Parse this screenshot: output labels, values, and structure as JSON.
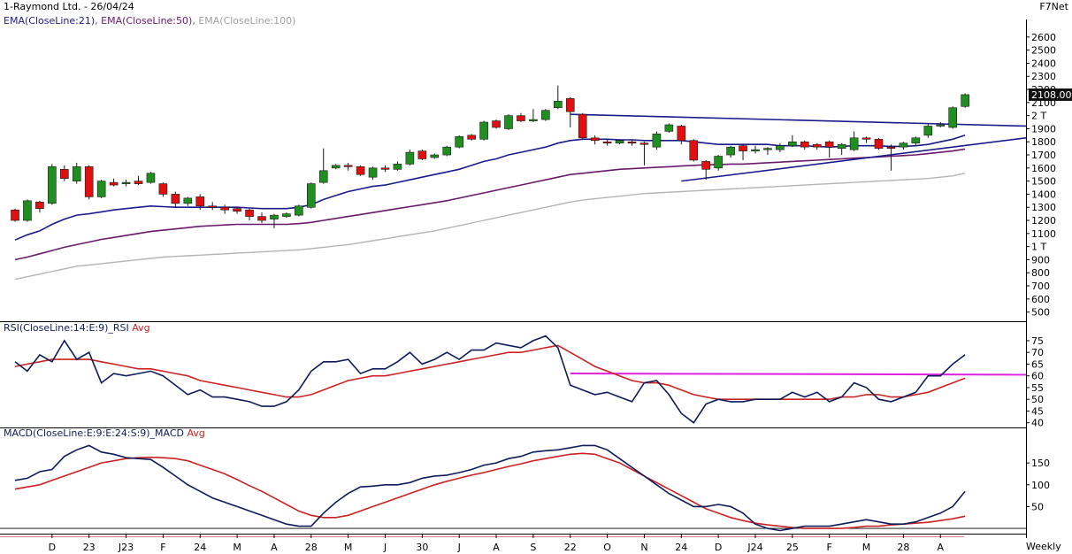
{
  "header": {
    "title": "1-Raymond Ltd. - 26/04/24",
    "brand": "F7Net",
    "ema_legend": [
      "EMA(CloseLine:21)",
      "EMA(CloseLine:50)",
      "EMA(CloseLine:100)"
    ],
    "rsi_label": "RSI(CloseLine:14:E:9)_RSI",
    "rsi_avg_label": "Avg",
    "macd_label": "MACD(CloseLine:E:9:E:24:S:9)_MACD",
    "macd_avg_label": "Avg",
    "last_price": "2108.00",
    "timeframe": "Weekly"
  },
  "colors": {
    "up": "#1f8f1f",
    "down": "#e01010",
    "ema21": "#1b1b8c",
    "ema50": "#6a1a6a",
    "ema100": "#b4b4b4",
    "rsi": "#0f1b5a",
    "rsi_avg": "#cc2222",
    "macd": "#0f1b5a",
    "macd_avg": "#cc2222",
    "level_line": "#e020e0"
  },
  "chart_data": [
    {
      "type": "candlestick",
      "panel": "price",
      "y_axis_labels": [
        "2600",
        "2500",
        "2400",
        "2300",
        "2200",
        "2100",
        "2 T",
        "1900",
        "1800",
        "1700",
        "1600",
        "1500",
        "1400",
        "1300",
        "1200",
        "1100",
        "1 T",
        "900",
        "800",
        "700",
        "600",
        "500"
      ],
      "ylim": [
        430,
        2680
      ],
      "candles": [
        [
          1280,
          1200,
          1290,
          1190
        ],
        [
          1200,
          1350,
          1360,
          1190
        ],
        [
          1340,
          1290,
          1350,
          1260
        ],
        [
          1330,
          1610,
          1630,
          1320
        ],
        [
          1590,
          1520,
          1620,
          1500
        ],
        [
          1500,
          1610,
          1640,
          1480
        ],
        [
          1610,
          1380,
          1620,
          1360
        ],
        [
          1380,
          1500,
          1510,
          1370
        ],
        [
          1490,
          1470,
          1520,
          1460
        ],
        [
          1480,
          1490,
          1510,
          1460
        ],
        [
          1500,
          1480,
          1540,
          1470
        ],
        [
          1490,
          1560,
          1570,
          1480
        ],
        [
          1480,
          1400,
          1490,
          1380
        ],
        [
          1400,
          1330,
          1420,
          1300
        ],
        [
          1330,
          1370,
          1380,
          1310
        ],
        [
          1380,
          1310,
          1400,
          1280
        ],
        [
          1310,
          1300,
          1340,
          1280
        ],
        [
          1300,
          1280,
          1320,
          1250
        ],
        [
          1290,
          1270,
          1300,
          1250
        ],
        [
          1280,
          1230,
          1290,
          1200
        ],
        [
          1230,
          1200,
          1260,
          1180
        ],
        [
          1210,
          1240,
          1250,
          1140
        ],
        [
          1230,
          1250,
          1260,
          1220
        ],
        [
          1240,
          1310,
          1320,
          1230
        ],
        [
          1300,
          1480,
          1490,
          1290
        ],
        [
          1490,
          1580,
          1750,
          1480
        ],
        [
          1600,
          1620,
          1630,
          1590
        ],
        [
          1620,
          1610,
          1640,
          1580
        ],
        [
          1610,
          1550,
          1620,
          1540
        ],
        [
          1530,
          1600,
          1610,
          1510
        ],
        [
          1600,
          1590,
          1620,
          1570
        ],
        [
          1590,
          1630,
          1650,
          1580
        ],
        [
          1630,
          1720,
          1740,
          1620
        ],
        [
          1730,
          1670,
          1740,
          1660
        ],
        [
          1680,
          1700,
          1710,
          1670
        ],
        [
          1700,
          1760,
          1770,
          1690
        ],
        [
          1760,
          1840,
          1850,
          1750
        ],
        [
          1850,
          1820,
          1860,
          1810
        ],
        [
          1820,
          1950,
          1960,
          1810
        ],
        [
          1960,
          1910,
          1970,
          1900
        ],
        [
          1900,
          2000,
          2010,
          1890
        ],
        [
          2000,
          1960,
          2020,
          1950
        ],
        [
          1960,
          1970,
          2050,
          1950
        ],
        [
          1970,
          2040,
          2050,
          1960
        ],
        [
          2060,
          2110,
          2230,
          2050
        ],
        [
          2130,
          2030,
          2140,
          1910
        ],
        [
          2010,
          1830,
          2020,
          1820
        ],
        [
          1830,
          1810,
          1850,
          1780
        ],
        [
          1800,
          1790,
          1820,
          1770
        ],
        [
          1790,
          1810,
          1820,
          1780
        ],
        [
          1800,
          1790,
          1820,
          1770
        ],
        [
          1790,
          1780,
          1800,
          1620
        ],
        [
          1760,
          1860,
          1880,
          1740
        ],
        [
          1880,
          1930,
          1940,
          1870
        ],
        [
          1920,
          1810,
          1930,
          1780
        ],
        [
          1810,
          1660,
          1820,
          1650
        ],
        [
          1650,
          1590,
          1660,
          1510
        ],
        [
          1600,
          1690,
          1700,
          1580
        ],
        [
          1700,
          1760,
          1770,
          1680
        ],
        [
          1770,
          1730,
          1780,
          1660
        ],
        [
          1730,
          1740,
          1770,
          1710
        ],
        [
          1740,
          1750,
          1760,
          1700
        ],
        [
          1740,
          1770,
          1790,
          1720
        ],
        [
          1770,
          1800,
          1850,
          1760
        ],
        [
          1800,
          1760,
          1810,
          1740
        ],
        [
          1780,
          1760,
          1790,
          1740
        ],
        [
          1800,
          1760,
          1810,
          1680
        ],
        [
          1750,
          1780,
          1790,
          1700
        ],
        [
          1740,
          1830,
          1880,
          1730
        ],
        [
          1830,
          1820,
          1840,
          1790
        ],
        [
          1820,
          1750,
          1830,
          1740
        ],
        [
          1760,
          1750,
          1780,
          1580
        ],
        [
          1760,
          1790,
          1800,
          1740
        ],
        [
          1790,
          1830,
          1840,
          1770
        ],
        [
          1850,
          1920,
          1940,
          1830
        ],
        [
          1930,
          1930,
          1950,
          1910
        ],
        [
          1910,
          2060,
          2070,
          1900
        ],
        [
          2070,
          2160,
          2170,
          2060
        ]
      ],
      "ema21": [
        1050,
        1090,
        1120,
        1170,
        1210,
        1240,
        1250,
        1265,
        1280,
        1290,
        1300,
        1310,
        1305,
        1300,
        1300,
        1300,
        1300,
        1300,
        1300,
        1295,
        1290,
        1290,
        1290,
        1300,
        1320,
        1360,
        1390,
        1420,
        1440,
        1460,
        1470,
        1490,
        1510,
        1530,
        1550,
        1570,
        1590,
        1620,
        1650,
        1670,
        1700,
        1720,
        1740,
        1760,
        1790,
        1810,
        1820,
        1820,
        1820,
        1815,
        1815,
        1810,
        1810,
        1810,
        1810,
        1800,
        1790,
        1780,
        1780,
        1780,
        1780,
        1780,
        1770,
        1770,
        1770,
        1765,
        1760,
        1765,
        1770,
        1770,
        1770,
        1765,
        1765,
        1770,
        1780,
        1800,
        1820,
        1850
      ],
      "ema50": [
        900,
        920,
        945,
        970,
        995,
        1015,
        1035,
        1055,
        1070,
        1085,
        1100,
        1115,
        1125,
        1135,
        1145,
        1155,
        1160,
        1165,
        1170,
        1170,
        1170,
        1170,
        1170,
        1175,
        1185,
        1200,
        1215,
        1230,
        1245,
        1260,
        1275,
        1290,
        1305,
        1320,
        1335,
        1350,
        1370,
        1390,
        1410,
        1430,
        1450,
        1470,
        1490,
        1510,
        1530,
        1550,
        1560,
        1570,
        1580,
        1590,
        1595,
        1600,
        1605,
        1610,
        1615,
        1620,
        1625,
        1625,
        1630,
        1630,
        1635,
        1640,
        1645,
        1650,
        1655,
        1660,
        1665,
        1670,
        1675,
        1680,
        1685,
        1690,
        1695,
        1700,
        1710,
        1720,
        1730,
        1745
      ],
      "ema100": [
        750,
        770,
        790,
        810,
        830,
        850,
        860,
        870,
        880,
        890,
        900,
        910,
        920,
        925,
        930,
        935,
        940,
        945,
        950,
        955,
        960,
        965,
        970,
        975,
        985,
        995,
        1005,
        1015,
        1030,
        1045,
        1060,
        1075,
        1090,
        1105,
        1120,
        1140,
        1160,
        1180,
        1200,
        1220,
        1240,
        1260,
        1280,
        1300,
        1320,
        1340,
        1355,
        1365,
        1375,
        1385,
        1395,
        1405,
        1410,
        1415,
        1420,
        1425,
        1430,
        1435,
        1440,
        1445,
        1450,
        1455,
        1460,
        1465,
        1470,
        1475,
        1480,
        1485,
        1490,
        1495,
        1500,
        1505,
        1510,
        1515,
        1520,
        1530,
        1540,
        1560
      ],
      "trendlines": [
        {
          "from": [
            45,
            2010
          ],
          "to": [
            107,
            1920
          ]
        },
        {
          "from": [
            54,
            1500
          ],
          "to": [
            107,
            1830
          ]
        }
      ],
      "x_labels": [
        {
          "i": 3,
          "t": "D"
        },
        {
          "i": 6,
          "t": "23"
        },
        {
          "i": 9,
          "t": "J23"
        },
        {
          "i": 12,
          "t": "F"
        },
        {
          "i": 15,
          "t": "24"
        },
        {
          "i": 18,
          "t": "M"
        },
        {
          "i": 21,
          "t": "A"
        },
        {
          "i": 24,
          "t": "28"
        },
        {
          "i": 27,
          "t": "M"
        },
        {
          "i": 30,
          "t": "J"
        },
        {
          "i": 33,
          "t": "30"
        },
        {
          "i": 36,
          "t": "J"
        },
        {
          "i": 39,
          "t": "A"
        },
        {
          "i": 42,
          "t": "S"
        },
        {
          "i": 45,
          "t": "22"
        },
        {
          "i": 48,
          "t": "O"
        },
        {
          "i": 51,
          "t": "N"
        },
        {
          "i": 54,
          "t": "24"
        },
        {
          "i": 57,
          "t": "D"
        },
        {
          "i": 60,
          "t": "J24"
        },
        {
          "i": 63,
          "t": "25"
        },
        {
          "i": 66,
          "t": "F"
        },
        {
          "i": 69,
          "t": "M"
        },
        {
          "i": 72,
          "t": "28"
        },
        {
          "i": 75,
          "t": "A"
        }
      ]
    },
    {
      "type": "line",
      "panel": "rsi",
      "y_axis_labels": [
        "75",
        "70",
        "65",
        "60",
        "55",
        "50",
        "45",
        "40"
      ],
      "ylim": [
        38,
        78
      ],
      "rsi": [
        66,
        62,
        69,
        66,
        75,
        67,
        70,
        57,
        61,
        60,
        61,
        62,
        60,
        56,
        52,
        54,
        51,
        51,
        50,
        49,
        47,
        47,
        49,
        54,
        62,
        66,
        66,
        67,
        61,
        63,
        63,
        66,
        70,
        65,
        67,
        70,
        67,
        71,
        71,
        74,
        73,
        72,
        75,
        77,
        72,
        56,
        54,
        52,
        53,
        51,
        49,
        57,
        58,
        52,
        44,
        40,
        48,
        50,
        49,
        49,
        50,
        50,
        50,
        53,
        51,
        53,
        49,
        51,
        57,
        55,
        50,
        49,
        51,
        53,
        60,
        60,
        65,
        69
      ],
      "rsi_avg": [
        64,
        65,
        66,
        67,
        67,
        67,
        67,
        66,
        65,
        64,
        63,
        63,
        62,
        61,
        60,
        58,
        57,
        56,
        55,
        54,
        53,
        52,
        51,
        51,
        52,
        54,
        56,
        58,
        59,
        60,
        60,
        61,
        62,
        63,
        64,
        65,
        66,
        67,
        68,
        69,
        70,
        70,
        71,
        72,
        73,
        70,
        67,
        64,
        62,
        60,
        58,
        57,
        57,
        56,
        54,
        52,
        51,
        50,
        50,
        50,
        50,
        50,
        50,
        50,
        50,
        50,
        50,
        51,
        51,
        52,
        52,
        51,
        51,
        52,
        53,
        55,
        57,
        59
      ],
      "level_line": {
        "from": [
          45,
          61
        ],
        "to": [
          107,
          60.5
        ]
      }
    },
    {
      "type": "line",
      "panel": "macd",
      "y_axis_labels": [
        "150",
        "100",
        "50"
      ],
      "ylim": [
        -12,
        205
      ],
      "macd": [
        110,
        115,
        130,
        135,
        165,
        180,
        190,
        175,
        170,
        162,
        160,
        158,
        140,
        120,
        100,
        85,
        70,
        60,
        50,
        40,
        30,
        20,
        10,
        5,
        5,
        35,
        60,
        80,
        95,
        97,
        100,
        100,
        105,
        115,
        120,
        122,
        128,
        135,
        145,
        150,
        160,
        165,
        175,
        178,
        180,
        185,
        190,
        190,
        180,
        160,
        140,
        120,
        100,
        80,
        65,
        50,
        50,
        55,
        50,
        35,
        10,
        0,
        -5,
        0,
        5,
        5,
        5,
        10,
        15,
        20,
        15,
        10,
        10,
        15,
        25,
        35,
        50,
        85
      ],
      "macd_avg": [
        90,
        95,
        100,
        110,
        120,
        130,
        140,
        150,
        155,
        160,
        162,
        163,
        162,
        160,
        155,
        145,
        135,
        125,
        112,
        98,
        85,
        70,
        55,
        40,
        30,
        25,
        25,
        30,
        40,
        50,
        60,
        70,
        80,
        90,
        100,
        108,
        115,
        122,
        128,
        135,
        142,
        148,
        155,
        160,
        165,
        170,
        172,
        170,
        160,
        150,
        135,
        120,
        105,
        90,
        75,
        60,
        45,
        35,
        25,
        18,
        12,
        8,
        5,
        2,
        0,
        0,
        0,
        0,
        2,
        5,
        5,
        8,
        10,
        12,
        14,
        18,
        22,
        28
      ]
    }
  ]
}
